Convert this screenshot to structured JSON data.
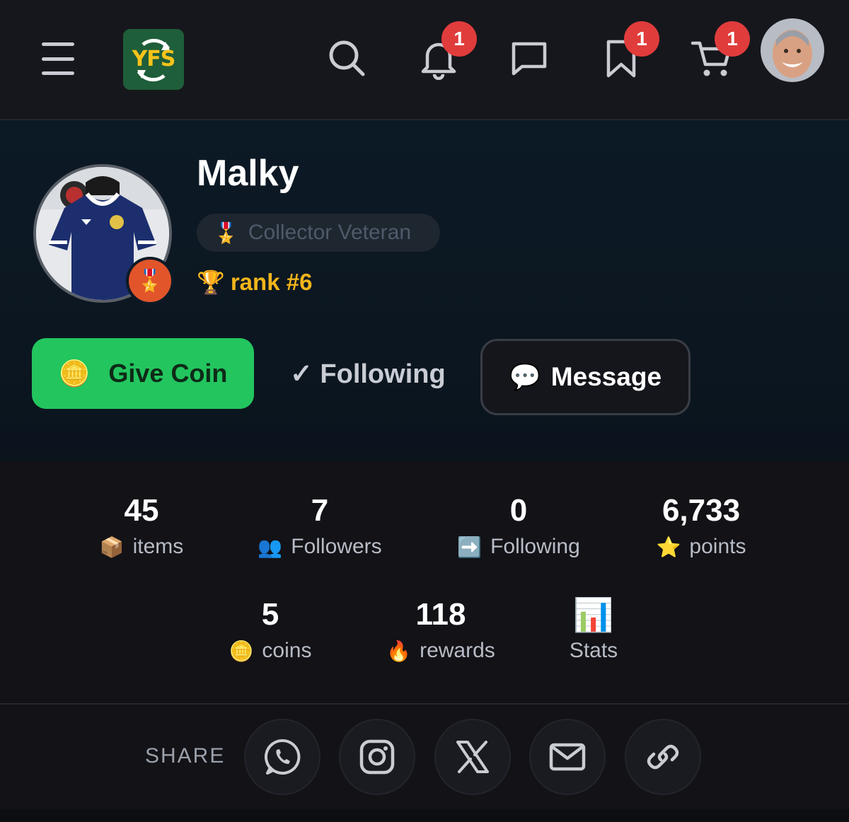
{
  "header": {
    "logo_text": "YFS",
    "notifications_count": "1",
    "saved_count": "1",
    "cart_count": "1"
  },
  "profile": {
    "name": "Malky",
    "title_icon": "🎖️",
    "title": "Collector Veteran",
    "rank_icon": "🏆",
    "rank": "rank #6"
  },
  "actions": {
    "give_coin_icon": "🪙",
    "give_coin": "Give Coin",
    "following": "✓ Following",
    "message_icon": "💬",
    "message": "Message"
  },
  "stats": [
    {
      "value": "45",
      "icon": "📦",
      "label": "items"
    },
    {
      "value": "7",
      "icon": "👥",
      "label": "Followers"
    },
    {
      "value": "0",
      "icon": "➡️",
      "label": "Following"
    },
    {
      "value": "6,733",
      "icon": "⭐",
      "label": "points"
    },
    {
      "value": "5",
      "icon": "🪙",
      "label": "coins"
    },
    {
      "value": "118",
      "icon": "🔥",
      "label": "rewards"
    },
    {
      "value": "",
      "icon": "📊",
      "label": "Stats"
    }
  ],
  "share": {
    "label": "SHARE",
    "targets": [
      "whatsapp-icon",
      "instagram-icon",
      "x-icon",
      "mail-icon",
      "link-icon"
    ]
  },
  "colors": {
    "accent_green": "#22c55e",
    "badge_red": "#e03c3c",
    "rank_gold": "#f2b51b"
  }
}
